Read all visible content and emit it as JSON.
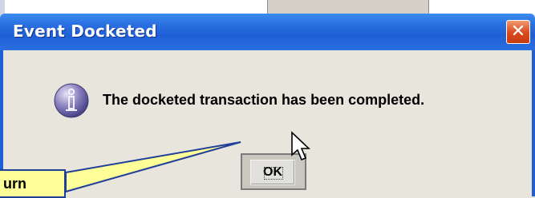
{
  "dialog": {
    "title": "Event Docketed",
    "message": "The docketed transaction has been completed.",
    "ok_label": "OK",
    "close_glyph": "✕",
    "icon": "info-icon"
  },
  "callout": {
    "text": "urn"
  },
  "colors": {
    "titlebar": "#2a6fe0",
    "close": "#d9481d",
    "callout_fill": "#ffff99",
    "callout_border": "#1f3f99"
  }
}
